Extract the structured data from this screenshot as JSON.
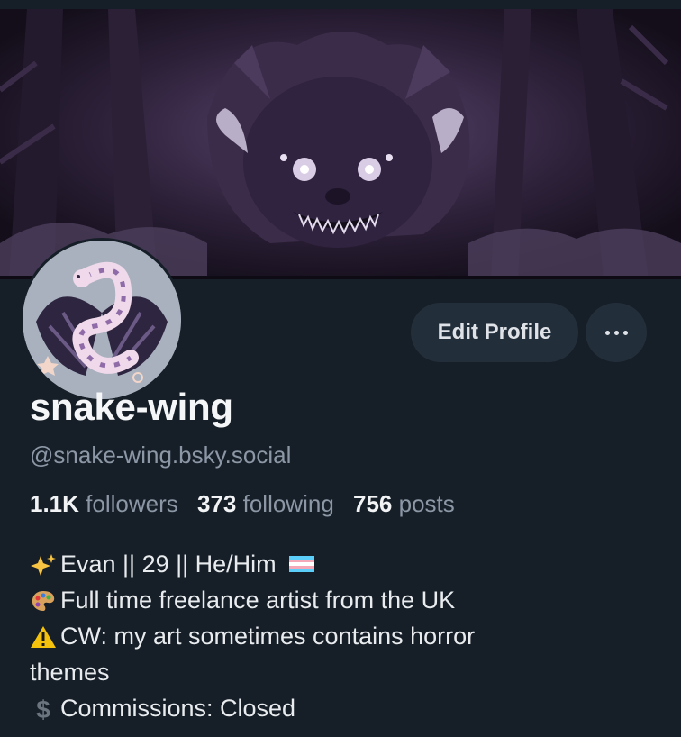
{
  "profile": {
    "display_name": "snake-wing",
    "handle": "@snake-wing.bsky.social",
    "stats": {
      "followers_count": "1.1K",
      "followers_label": "followers",
      "following_count": "373",
      "following_label": "following",
      "posts_count": "756",
      "posts_label": "posts"
    },
    "bio": [
      {
        "icon": "sparkles-icon",
        "text": "Evan || 29 || He/Him",
        "trailing_icon": "trans-flag-icon"
      },
      {
        "icon": "palette-icon",
        "text": "Full time freelance artist from the UK"
      },
      {
        "icon": "warning-icon",
        "text": "CW: my art sometimes contains horror"
      },
      {
        "icon": "",
        "text": "themes"
      },
      {
        "icon": "dollar-sign-icon",
        "text": "Commissions: Closed"
      }
    ]
  },
  "actions": {
    "edit_profile_label": "Edit Profile",
    "more_icon": "ellipsis-icon"
  },
  "colors": {
    "background": "#161e27",
    "button_bg": "#232e3b",
    "muted_text": "#8c97a6",
    "banner_tone": "#3a2a48"
  }
}
